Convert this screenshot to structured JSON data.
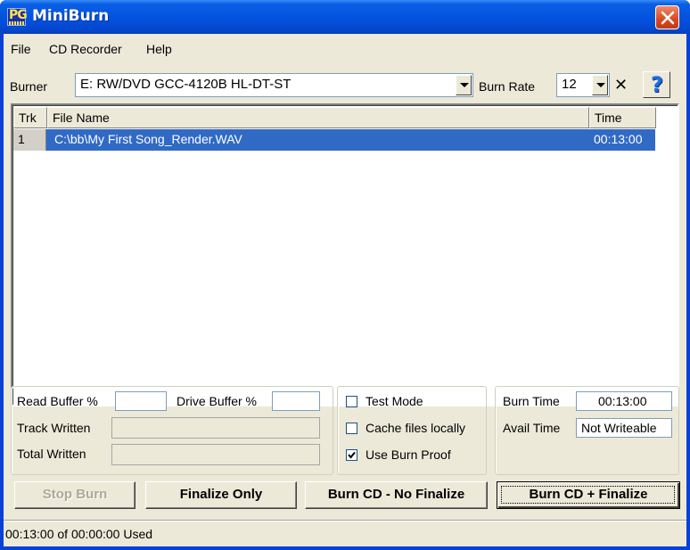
{
  "window": {
    "title": "MiniBurn",
    "icon": "pg-music-icon"
  },
  "menu": [
    "File",
    "CD Recorder",
    "Help"
  ],
  "burner": {
    "label": "Burner",
    "selected": "E: RW/DVD GCC-4120B HL-DT-ST",
    "rate_label": "Burn Rate",
    "rate_value": "12",
    "clear_icon": "x-icon",
    "help_icon": "help-question-icon"
  },
  "tracks": {
    "columns": [
      "Trk",
      "File Name",
      "Time"
    ],
    "rows": [
      {
        "trk": "1",
        "file": "C:\\bb\\My First Song_Render.WAV",
        "time": "00:13:00",
        "selected": true
      }
    ]
  },
  "buffers": {
    "read_label": "Read Buffer %",
    "read_value": "",
    "drive_label": "Drive Buffer %",
    "drive_value": "",
    "track_written_label": "Track Written",
    "total_written_label": "Total Written"
  },
  "options": {
    "test_mode": {
      "label": "Test Mode",
      "checked": false
    },
    "cache_files": {
      "label": "Cache files locally",
      "checked": false
    },
    "burn_proof": {
      "label": "Use Burn Proof",
      "checked": true
    }
  },
  "times": {
    "burn_time_label": "Burn Time",
    "burn_time_value": "00:13:00",
    "avail_time_label": "Avail Time",
    "avail_time_value": "Not Writeable"
  },
  "buttons": {
    "stop_burn": "Stop Burn",
    "finalize_only": "Finalize Only",
    "burn_no_finalize": "Burn CD - No Finalize",
    "burn_finalize": "Burn CD + Finalize"
  },
  "status": {
    "text": "00:13:00 of 00:00:00 Used"
  },
  "colors": {
    "titlebar": "#0453e0",
    "selection": "#316ac5",
    "face": "#ece9d8",
    "close": "#d8481f"
  }
}
